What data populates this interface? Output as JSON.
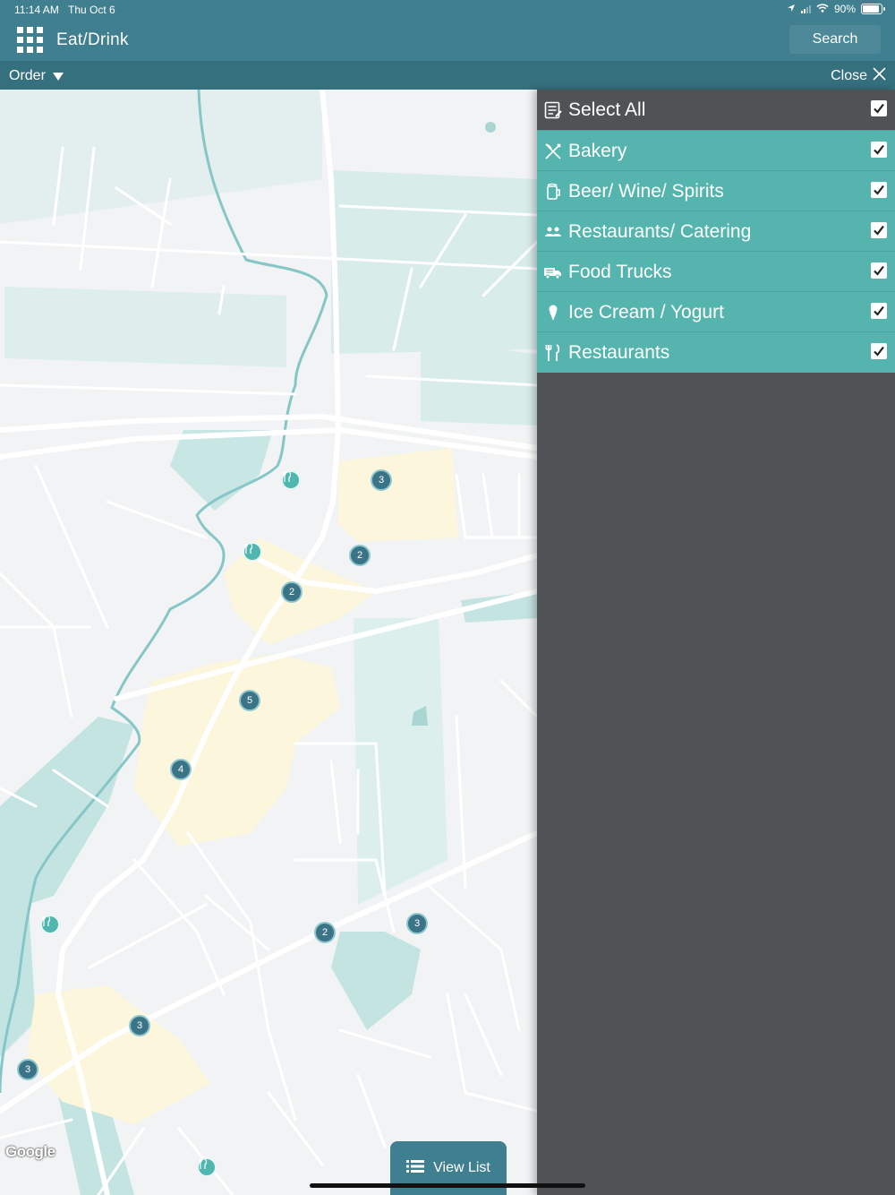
{
  "status": {
    "time": "11:14 AM",
    "date": "Thu Oct 6",
    "battery": "90%",
    "battery_level": 0.9
  },
  "header": {
    "title": "Eat/Drink",
    "search_label": "Search"
  },
  "subbar": {
    "order_label": "Order",
    "close_label": "Close"
  },
  "map": {
    "attribution": "Google",
    "clusters": [
      "3",
      "2",
      "2",
      "5",
      "4",
      "3",
      "2",
      "3",
      "3"
    ]
  },
  "filters": {
    "select_all": {
      "label": "Select All",
      "checked": true
    },
    "items": [
      {
        "label": "Bakery",
        "icon": "bakery-icon",
        "checked": true
      },
      {
        "label": "Beer/ Wine/ Spirits",
        "icon": "beer-icon",
        "checked": true
      },
      {
        "label": "Restaurants/ Catering",
        "icon": "catering-icon",
        "checked": true
      },
      {
        "label": "Food Trucks",
        "icon": "food-truck-icon",
        "checked": true
      },
      {
        "label": "Ice Cream / Yogurt",
        "icon": "ice-cream-icon",
        "checked": true
      },
      {
        "label": "Restaurants",
        "icon": "fork-knife-icon",
        "checked": true
      }
    ]
  },
  "footer": {
    "view_list_label": "View List"
  },
  "colors": {
    "header": "#3f7f90",
    "subbar": "#35707f",
    "filter_row": "#55b5ae",
    "panel": "#4f5356",
    "cluster": "#3c7487"
  }
}
